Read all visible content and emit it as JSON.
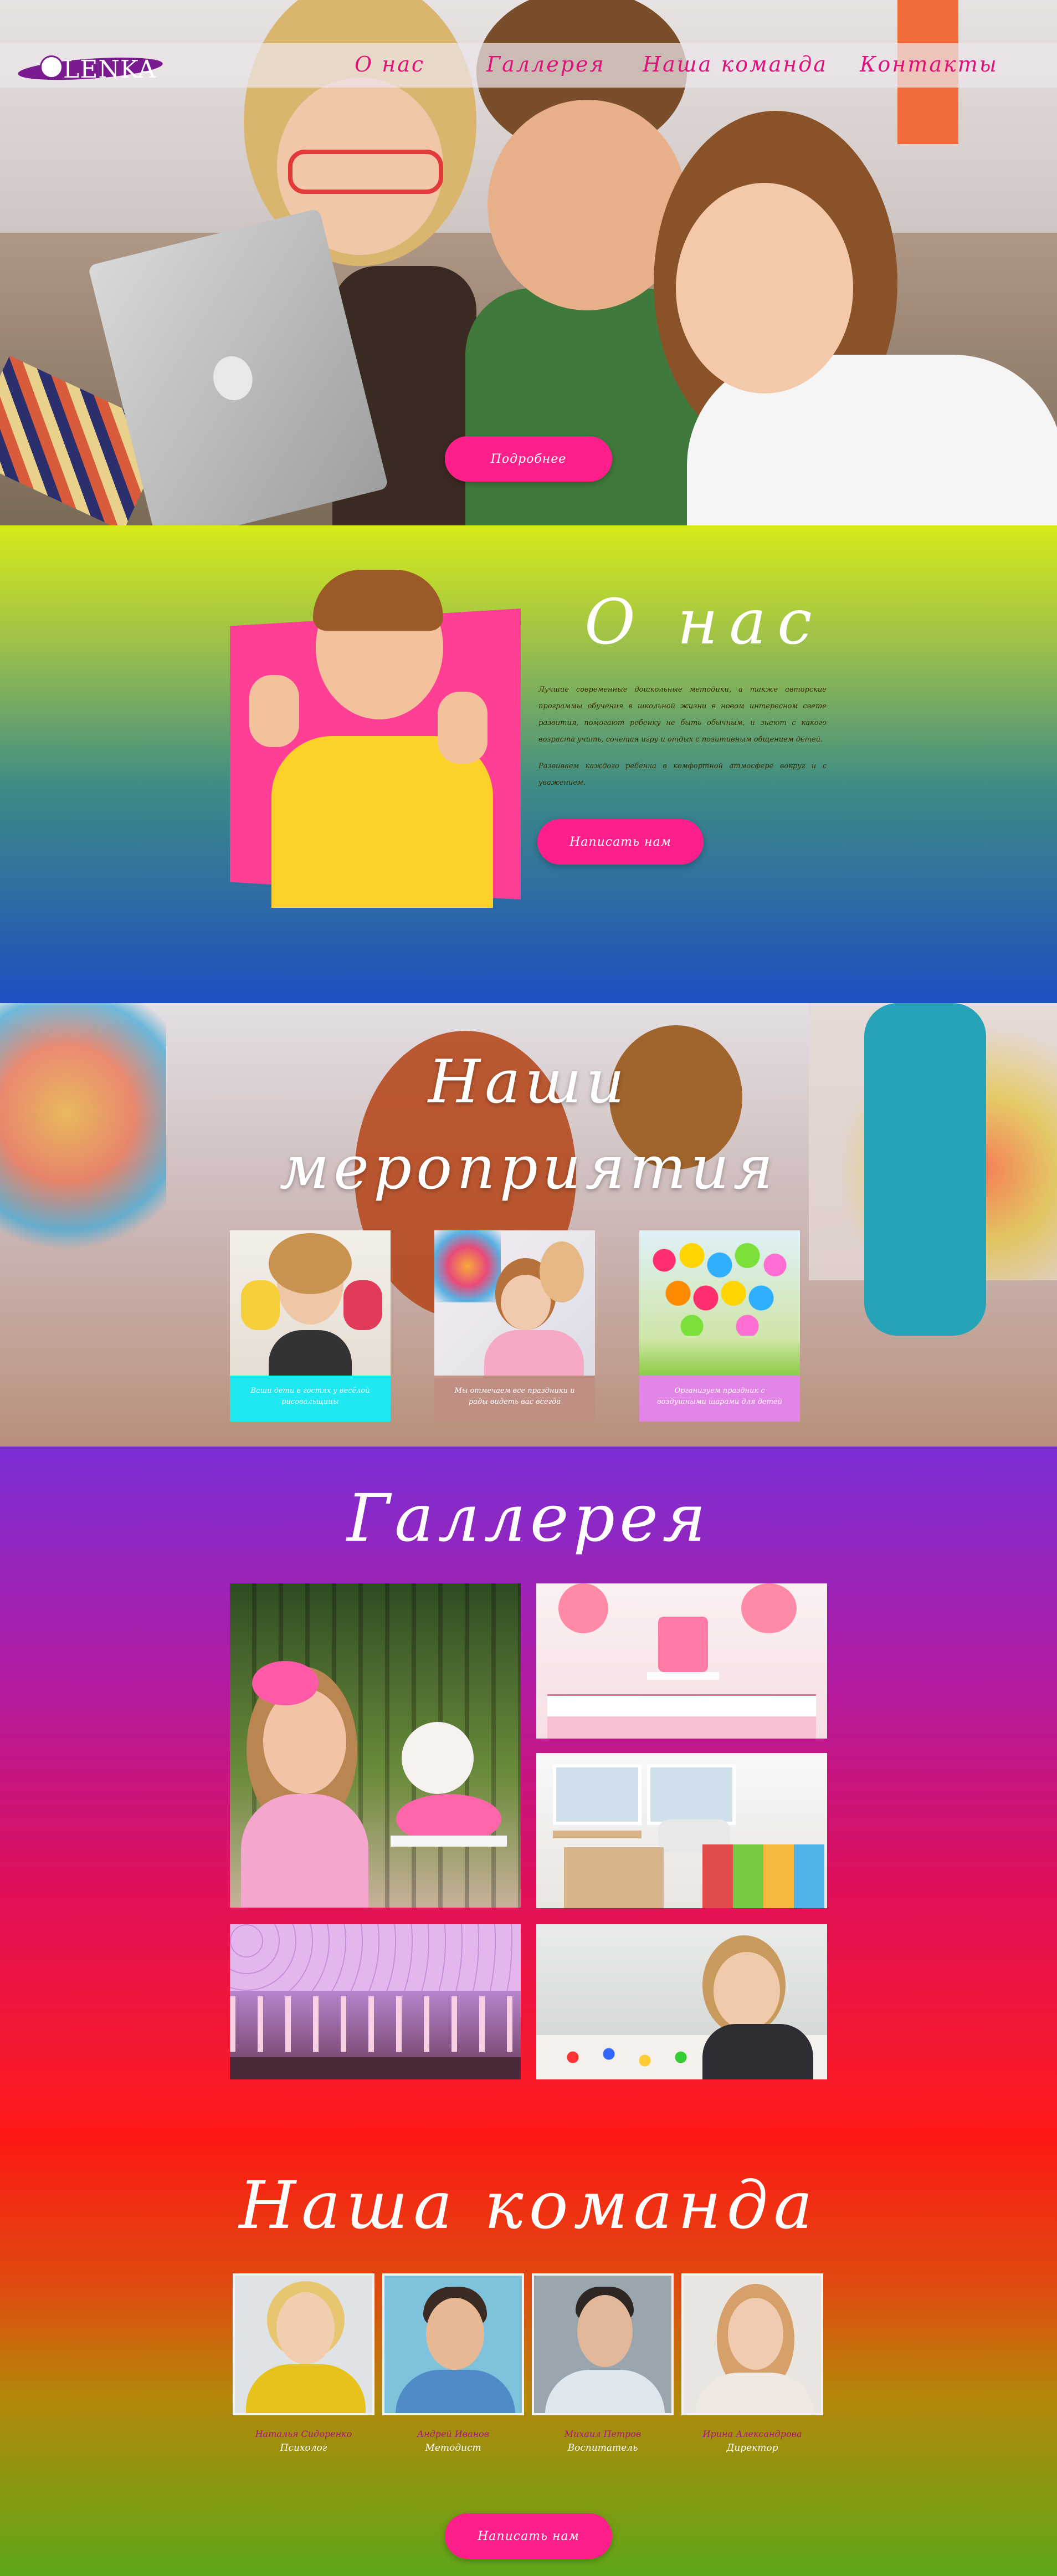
{
  "nav": {
    "logo": "LENKA",
    "items": [
      {
        "label": "О  нас"
      },
      {
        "label": "Галлерея"
      },
      {
        "label": "Наша команда"
      },
      {
        "label": "Контакты"
      }
    ]
  },
  "hero": {
    "button_label": "Подробнее"
  },
  "about": {
    "title": "О  нас",
    "paragraph1": "Лучшие современные дошкольные методики, а также авторские программы обучения в школьной жизни в новом интересном свете развития, помогают ребенку не быть обычным, и знают с какого возраста учить, сочетая игру и отдых с позитивным общением детей.",
    "paragraph2": "Развиваем каждого ребенка в комфортной атмосфере вокруг и с уважением.",
    "button_label": "Написать нам"
  },
  "events": {
    "title_line1": "Наши",
    "title_line2": "мероприятия",
    "cards": [
      {
        "caption": "Ваши дети в гостях у весёлой рисовальщицы",
        "color": "#1ee8f2"
      },
      {
        "caption": "Мы отмечаем все праздники и рады видеть вас всегда",
        "color": "#c08f83"
      },
      {
        "caption": "Организуем праздник с воздушными шарами для детей",
        "color": "#e385e6"
      }
    ]
  },
  "gallery": {
    "title": "Галлерея"
  },
  "team": {
    "title": "Наша  команда",
    "members": [
      {
        "name": "Наталья Сидоренко",
        "role": "Психолог"
      },
      {
        "name": "Андрей Иванов",
        "role": "Методист"
      },
      {
        "name": "Михаил Петров",
        "role": "Воспитатель"
      },
      {
        "name": "Ирина Александрова",
        "role": "Директор"
      }
    ],
    "button_label": "Написать нам"
  },
  "colors": {
    "accent": "#ff1f8b",
    "nav_link": "#e0117a",
    "logo": "#7a1c8f"
  }
}
